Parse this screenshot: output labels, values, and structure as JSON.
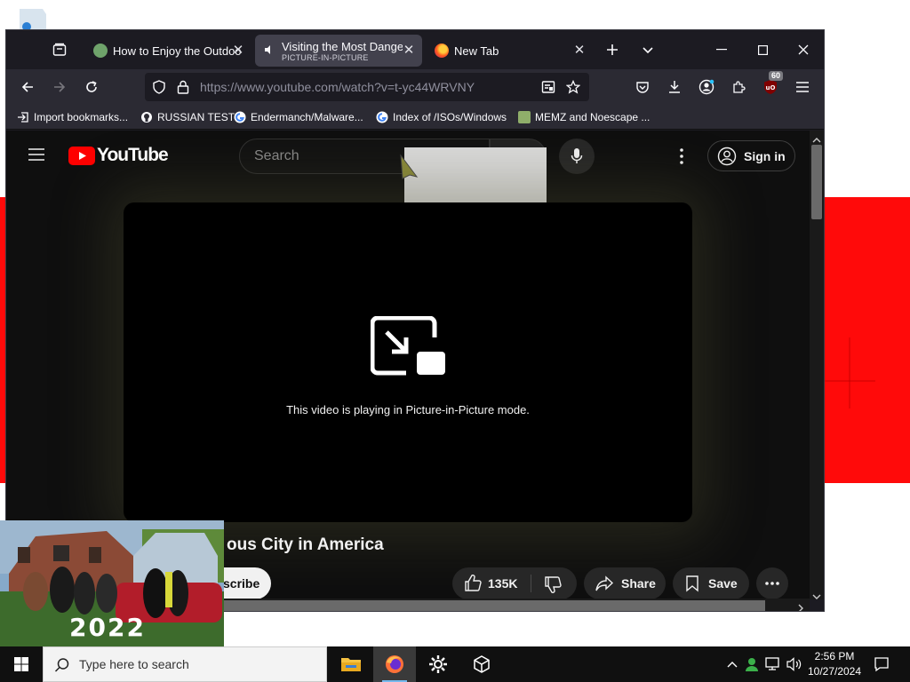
{
  "browser": {
    "tabs": [
      {
        "title": "How to Enjoy the Outdoo",
        "subtitle": "",
        "active": false
      },
      {
        "title": "Visiting the Most Dange",
        "subtitle": "PICTURE-IN-PICTURE",
        "active": true
      },
      {
        "title": "New Tab",
        "subtitle": "",
        "active": false
      }
    ],
    "url": "https://www.youtube.com/watch?v=t-yc44WRVNY",
    "extension_badge": "60",
    "bookmarks": [
      {
        "label": "Import bookmarks...",
        "icon": "import-icon"
      },
      {
        "label": "RUSSIAN TEST",
        "icon": "github-icon"
      },
      {
        "label": "Endermanch/Malware...",
        "icon": "google-icon"
      },
      {
        "label": "Index of /ISOs/Windows",
        "icon": "google-icon"
      },
      {
        "label": "MEMZ and Noescape ...",
        "icon": "site-icon"
      }
    ]
  },
  "youtube": {
    "logo_text": "YouTube",
    "search_placeholder": "Search",
    "sign_in": "Sign in",
    "pip_message": "This video is playing in Picture-in-Picture mode.",
    "video_title_visible": "ous City in America",
    "subscribe_visible": "scribe",
    "likes": "135K",
    "share": "Share",
    "save": "Save"
  },
  "pip_window": {
    "overlay_text": "2022"
  },
  "taskbar": {
    "search_placeholder": "Type here to search",
    "time": "2:56 PM",
    "date": "10/27/2024"
  },
  "colors": {
    "browser_dark": "#1c1b22",
    "toolbar": "#2b2a33",
    "youtube_red": "#ff0000",
    "desktop_red": "#ff0a0a"
  }
}
